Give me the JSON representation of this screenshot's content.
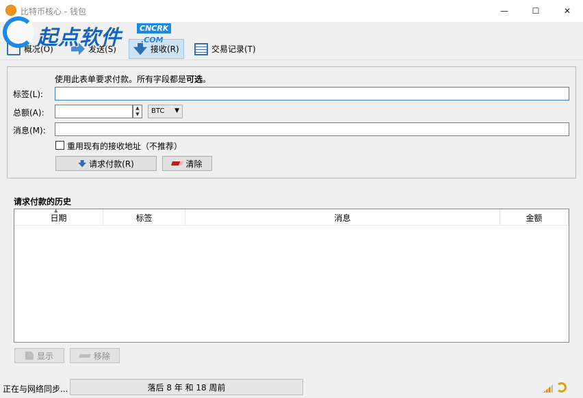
{
  "window": {
    "title": "比特币核心 - 钱包",
    "buttons": {
      "minimize": "—",
      "maximize": "☐",
      "close": "✕"
    }
  },
  "watermark": {
    "text": "起点软件",
    "badge": "CNCRK",
    "sub": ".COM"
  },
  "toolbar": {
    "items": [
      {
        "label": "概况(O)",
        "icon": "home-icon"
      },
      {
        "label": "发送(S)",
        "icon": "send-icon"
      },
      {
        "label": "接收(R)",
        "icon": "receive-icon",
        "active": true
      },
      {
        "label": "交易记录(T)",
        "icon": "history-list-icon"
      }
    ]
  },
  "form": {
    "instruction_prefix": "使用此表单要求付款。所有字段都是",
    "instruction_bold": "可选",
    "instruction_suffix": "。",
    "label_label": "标签(L):",
    "label_value": "",
    "amount_label": "总额(A):",
    "amount_value": "",
    "unit": "BTC",
    "message_label": "消息(M):",
    "message_value": "",
    "reuse_checkbox_label": "重用现有的接收地址（不推荐）",
    "reuse_checked": false,
    "request_button": "请求付款(R)",
    "clear_button": "清除"
  },
  "history": {
    "title": "请求付款的历史",
    "columns": [
      "日期",
      "标签",
      "消息",
      "金额"
    ],
    "rows": [],
    "show_button": "显示",
    "remove_button": "移除"
  },
  "status": {
    "text": "正在与网络同步...",
    "progress_text": "落后 8 年 和 18 周前"
  }
}
